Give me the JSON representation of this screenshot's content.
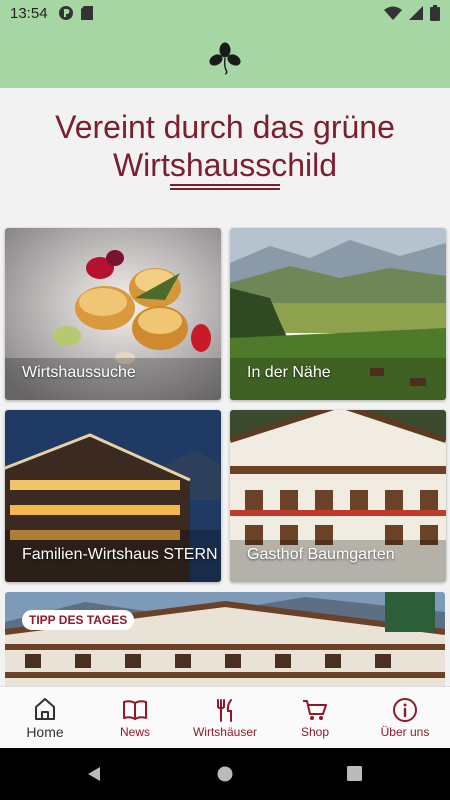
{
  "status": {
    "time": "13:54"
  },
  "header": {
    "logo": "clover-logo"
  },
  "main": {
    "title": "Vereint durch das grüne Wirtshausschild",
    "tiles": [
      {
        "label": "Wirtshaussuche"
      },
      {
        "label": "In der Nähe"
      },
      {
        "label": "Familien-Wirtshaus STERN"
      },
      {
        "label": "Gasthof Baumgarten"
      }
    ],
    "tipp": {
      "badge": "TIPP DES TAGES"
    }
  },
  "nav": {
    "items": [
      {
        "label": "Home",
        "icon": "home-icon"
      },
      {
        "label": "News",
        "icon": "book-icon"
      },
      {
        "label": "Wirtshäuser",
        "icon": "fork-knife-icon"
      },
      {
        "label": "Shop",
        "icon": "cart-icon"
      },
      {
        "label": "Über uns",
        "icon": "info-icon"
      }
    ]
  },
  "colors": {
    "accent": "#8b1a2b",
    "header_bg": "#a5d6a3"
  }
}
